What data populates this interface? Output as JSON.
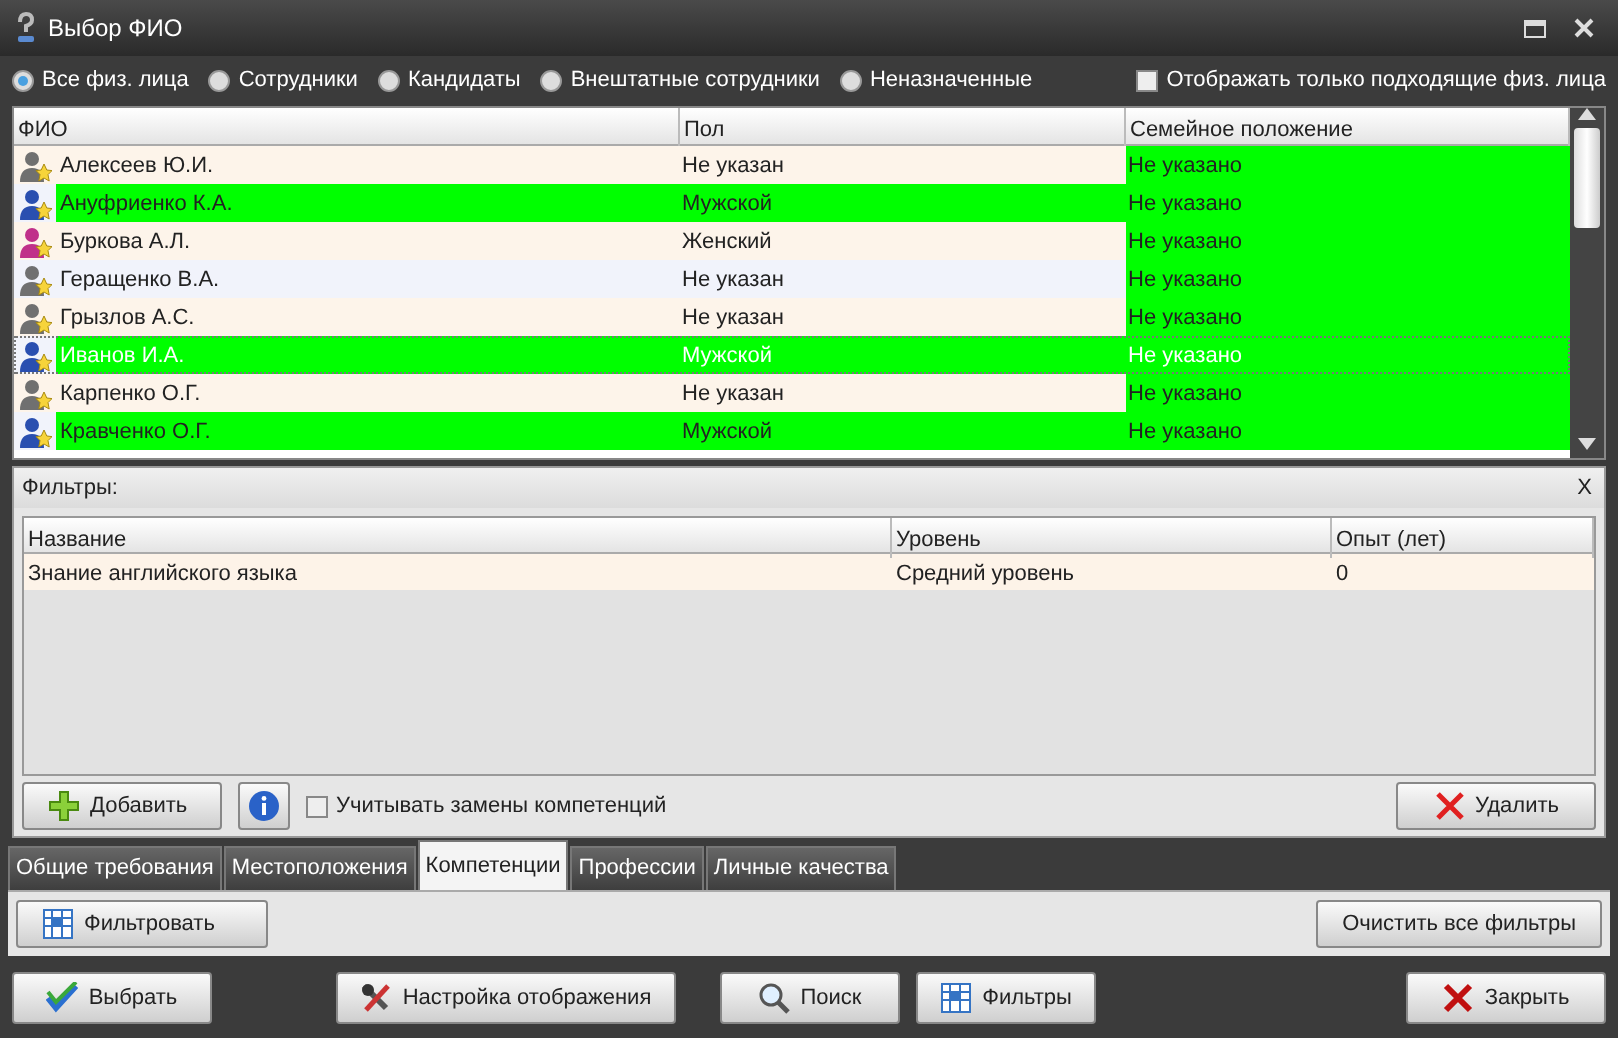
{
  "window": {
    "title": "Выбор ФИО"
  },
  "person_types": [
    {
      "label": "Все физ. лица",
      "selected": true
    },
    {
      "label": "Сотрудники",
      "selected": false
    },
    {
      "label": "Кандидаты",
      "selected": false
    },
    {
      "label": "Внештатные сотрудники",
      "selected": false
    },
    {
      "label": "Неназначенные",
      "selected": false
    }
  ],
  "only_matching": {
    "label": "Отображать только подходящие физ. лица",
    "checked": false
  },
  "people_table": {
    "columns": [
      "ФИО",
      "Пол",
      "Семейное положение"
    ],
    "rows": [
      {
        "name": "Алексеев Ю.И.",
        "gender": "Не указан",
        "marital": "Не указано",
        "color": "#707070",
        "match": false,
        "marital_match": true,
        "selected": false
      },
      {
        "name": "Ануфриенко К.А.",
        "gender": "Мужской",
        "marital": "Не указано",
        "color": "#2a4fb0",
        "match": true,
        "marital_match": true,
        "selected": false
      },
      {
        "name": "Буркова А.Л.",
        "gender": "Женский",
        "marital": "Не указано",
        "color": "#c0308a",
        "match": false,
        "marital_match": true,
        "selected": false
      },
      {
        "name": "Геращенко В.А.",
        "gender": "Не указан",
        "marital": "Не указано",
        "color": "#707070",
        "match": false,
        "marital_match": true,
        "selected": false
      },
      {
        "name": "Грызлов А.С.",
        "gender": "Не указан",
        "marital": "Не указано",
        "color": "#707070",
        "match": false,
        "marital_match": true,
        "selected": false
      },
      {
        "name": "Иванов И.А.",
        "gender": "Мужской",
        "marital": "Не указано",
        "color": "#2a4fb0",
        "match": true,
        "marital_match": true,
        "selected": true
      },
      {
        "name": "Карпенко О.Г.",
        "gender": "Не указан",
        "marital": "Не указано",
        "color": "#707070",
        "match": false,
        "marital_match": true,
        "selected": false
      },
      {
        "name": "Кравченко О.Г.",
        "gender": "Мужской",
        "marital": "Не указано",
        "color": "#2a4fb0",
        "match": true,
        "marital_match": true,
        "selected": false
      }
    ]
  },
  "filters": {
    "title": "Фильтры:",
    "close": "X",
    "columns": [
      "Название",
      "Уровень",
      "Опыт (лет)"
    ],
    "rows": [
      [
        "Знание английского языка",
        "Средний уровень",
        "0"
      ]
    ],
    "add_button": "Добавить",
    "consider_replacements": {
      "label": "Учитывать замены компетенций",
      "checked": false
    },
    "delete_button": "Удалить",
    "tabs": [
      {
        "label": "Общие требования",
        "selected": false
      },
      {
        "label": "Местоположения",
        "selected": false
      },
      {
        "label": "Компетенции",
        "selected": true
      },
      {
        "label": "Профессии",
        "selected": false
      },
      {
        "label": "Личные качества",
        "selected": false
      }
    ],
    "filter_button": "Фильтровать",
    "clear_button": "Очистить все фильтры"
  },
  "buttons": [
    {
      "kind": "select",
      "label": "Выбрать"
    },
    {
      "kind": "display",
      "label": "Настройка отображения"
    },
    {
      "kind": "search",
      "label": "Поиск"
    },
    {
      "kind": "filters",
      "label": "Фильтры"
    },
    {
      "kind": "close",
      "label": "Закрыть"
    }
  ]
}
